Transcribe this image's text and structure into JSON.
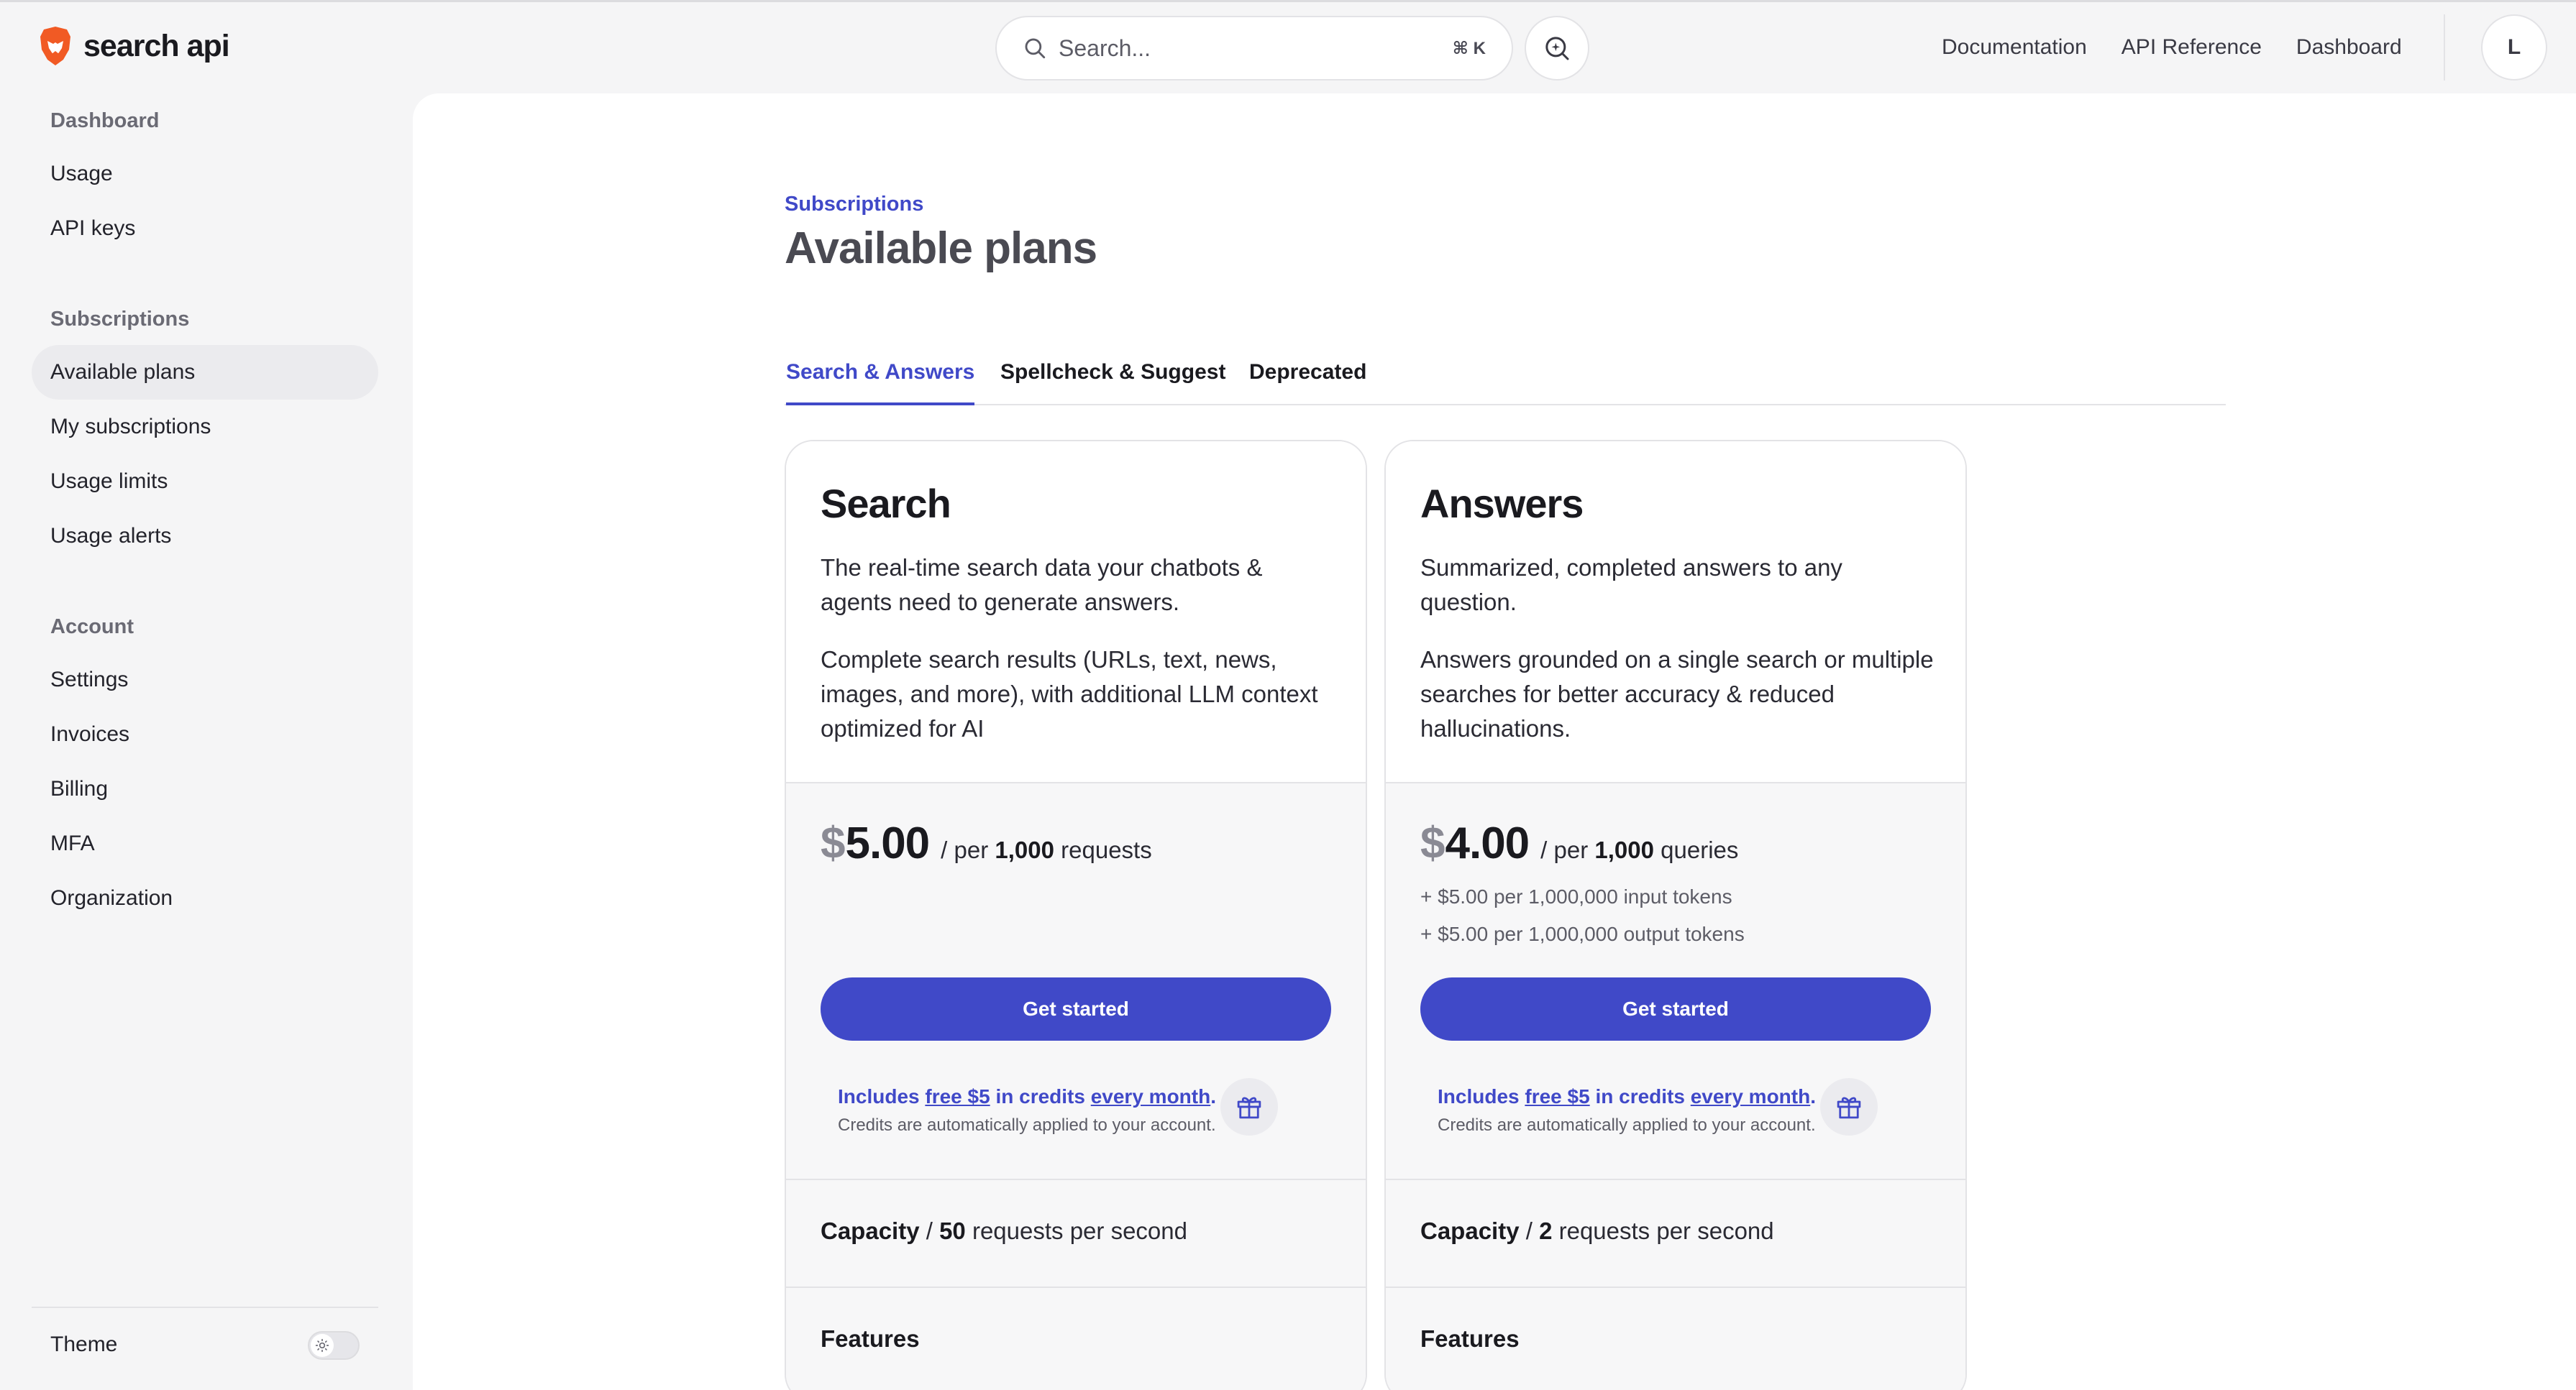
{
  "header": {
    "logo_text": "search api",
    "search_placeholder": "Search...",
    "search_shortcut": "⌘ K",
    "nav_links": [
      "Documentation",
      "API Reference",
      "Dashboard"
    ],
    "avatar_initial": "L"
  },
  "sidebar": {
    "sections": [
      {
        "title": "Dashboard",
        "items": [
          "Usage",
          "API keys"
        ]
      },
      {
        "title": "Subscriptions",
        "items": [
          "Available plans",
          "My subscriptions",
          "Usage limits",
          "Usage alerts"
        ]
      },
      {
        "title": "Account",
        "items": [
          "Settings",
          "Invoices",
          "Billing",
          "MFA",
          "Organization"
        ]
      }
    ],
    "active_item": "Available plans",
    "theme_label": "Theme"
  },
  "page": {
    "breadcrumb": "Subscriptions",
    "title": "Available plans",
    "tabs": [
      "Search & Answers",
      "Spellcheck & Suggest",
      "Deprecated"
    ],
    "active_tab": "Search & Answers"
  },
  "plans": [
    {
      "name": "Search",
      "desc1": "The real-time search data your chatbots & agents need to generate answers.",
      "desc2": "Complete search results (URLs, text, news, images, and more), with additional LLM context optimized for AI",
      "currency": "$",
      "price": "5.00",
      "per_prefix": "/ per",
      "per_amount": "1,000",
      "per_unit": "requests",
      "extras": [],
      "cta": "Get started",
      "credits_prefix": "Includes",
      "credits_link1": "free $5",
      "credits_mid": "in credits",
      "credits_link2": "every month",
      "credits_suffix": ".",
      "credits_note": "Credits are automatically applied to your account.",
      "capacity_label": "Capacity",
      "capacity_sep": "/",
      "capacity_value": "50",
      "capacity_unit": "requests per second",
      "features_label": "Features"
    },
    {
      "name": "Answers",
      "desc1": "Summarized, completed answers to any question.",
      "desc2": "Answers grounded on a single search or multiple searches for better accuracy & reduced hallucinations.",
      "currency": "$",
      "price": "4.00",
      "per_prefix": "/ per",
      "per_amount": "1,000",
      "per_unit": "queries",
      "extras": [
        "+ $5.00 per 1,000,000 input tokens",
        "+ $5.00 per 1,000,000 output tokens"
      ],
      "cta": "Get started",
      "credits_prefix": "Includes",
      "credits_link1": "free $5",
      "credits_mid": "in credits",
      "credits_link2": "every month",
      "credits_suffix": ".",
      "credits_note": "Credits are automatically applied to your account.",
      "capacity_label": "Capacity",
      "capacity_sep": "/",
      "capacity_value": "2",
      "capacity_unit": "requests per second",
      "features_label": "Features"
    }
  ],
  "colors": {
    "accent": "#4049c8",
    "logo": "#f15a24"
  }
}
